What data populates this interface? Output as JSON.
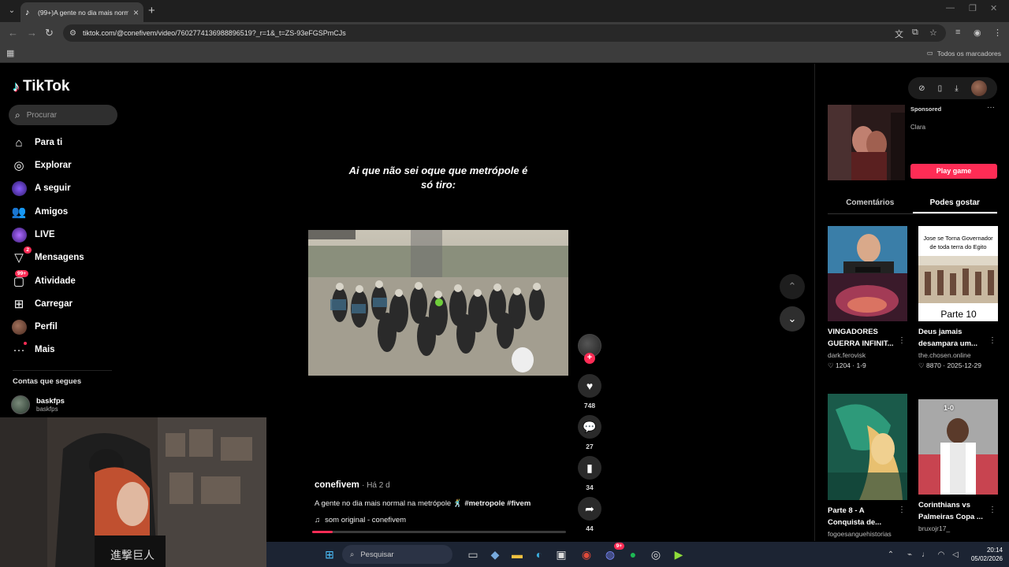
{
  "browser": {
    "tab_title": "(99+)A gente no dia mais norm",
    "url": "tiktok.com/@conefivem/video/7602774136988896519?_r=1&_t=ZS-93eFGSPmCJs",
    "bookmarks_all": "Todos os marcadores"
  },
  "sidebar": {
    "logo": "TikTok",
    "search_placeholder": "Procurar",
    "items": [
      {
        "label": "Para ti",
        "icon": "home-icon"
      },
      {
        "label": "Explorar",
        "icon": "compass-icon"
      },
      {
        "label": "A seguir",
        "icon": "following-avatar-icon"
      },
      {
        "label": "Amigos",
        "icon": "friends-icon"
      },
      {
        "label": "LIVE",
        "icon": "live-icon"
      },
      {
        "label": "Mensagens",
        "icon": "messages-icon",
        "badge": "2"
      },
      {
        "label": "Atividade",
        "icon": "activity-icon",
        "badge": "99+"
      },
      {
        "label": "Carregar",
        "icon": "upload-icon"
      },
      {
        "label": "Perfil",
        "icon": "profile-icon"
      },
      {
        "label": "Mais",
        "icon": "more-icon"
      }
    ],
    "following_heading": "Contas que segues",
    "following": [
      {
        "name": "baskfps",
        "handle": "baskfps"
      }
    ]
  },
  "video": {
    "overlay_caption": "Ai que não sei oque que metrópole é só tiro:",
    "author": "conefivem",
    "time": "Há 2 d",
    "description": "A gente no dia mais normal na metrópole 🕺",
    "hashtags": "#metropole #fivem",
    "sound": "som original - conefivem",
    "progress": 0.08,
    "likes": "748",
    "comments": "27",
    "saves": "34",
    "shares": "44"
  },
  "right_panel": {
    "ad": {
      "sponsored": "Sponsored",
      "name": "Clara",
      "cta": "Play game"
    },
    "tabs": [
      "Comentários",
      "Podes gostar"
    ],
    "active_tab": 1,
    "cards": [
      {
        "title": "VINGADORES GUERRA INFINIT...",
        "author": "dark.ferovisk",
        "likes": "1204",
        "date": "1-9",
        "overlay": ""
      },
      {
        "title": "Deus jamais desampara um...",
        "author": "the.chosen.online",
        "likes": "8870",
        "date": "2025-12-29",
        "overlay": "Jose se Torna Governador de toda terra do Egito",
        "overlay2": "Parte 10"
      },
      {
        "title": "Parte 8 - A Conquista de...",
        "author": "fogoesanguehistorias",
        "likes": "",
        "date": "",
        "overlay": ""
      },
      {
        "title": "Corinthians vs Palmeiras Copa ...",
        "author": "bruxojr17_",
        "likes": "",
        "date": "",
        "overlay": "1-0"
      }
    ]
  },
  "taskbar": {
    "search": "Pesquisar",
    "time": "20:14",
    "date": "05/02/2026",
    "discord_badge": "9+"
  },
  "colors": {
    "accent": "#fe2c55",
    "bg": "#000000",
    "taskbar": "#1c2433"
  }
}
